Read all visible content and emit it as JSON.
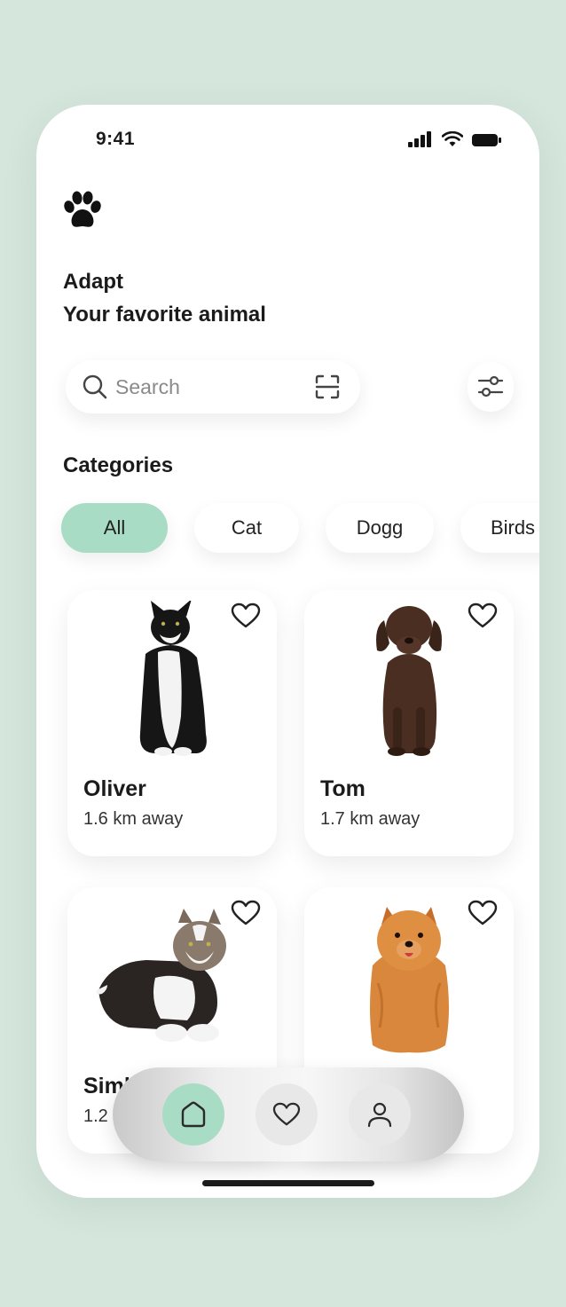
{
  "status_bar": {
    "time": "9:41"
  },
  "header": {
    "title_line1": "Adapt",
    "title_line2": "Your favorite animal"
  },
  "search": {
    "placeholder": "Search"
  },
  "categories": {
    "title": "Categories",
    "items": [
      {
        "label": "All",
        "active": true
      },
      {
        "label": "Cat"
      },
      {
        "label": "Dogg"
      },
      {
        "label": "Birds"
      }
    ]
  },
  "pets": [
    {
      "name": "Oliver",
      "distance": "1.6 km away",
      "kind": "cat-black-white-sitting"
    },
    {
      "name": "Tom",
      "distance": "1.7 km away",
      "kind": "dog-brown-puppy"
    },
    {
      "name": "Simba",
      "distance": "1.2 km away",
      "kind": "cat-lying"
    },
    {
      "name": "",
      "distance": "",
      "kind": "dog-pomeranian"
    }
  ],
  "navbar": {
    "items": [
      "home-icon",
      "heart-icon",
      "profile-icon"
    ],
    "active": "home-icon"
  },
  "colors": {
    "accent": "#a8dcc4",
    "background": "#d5e6dc"
  }
}
